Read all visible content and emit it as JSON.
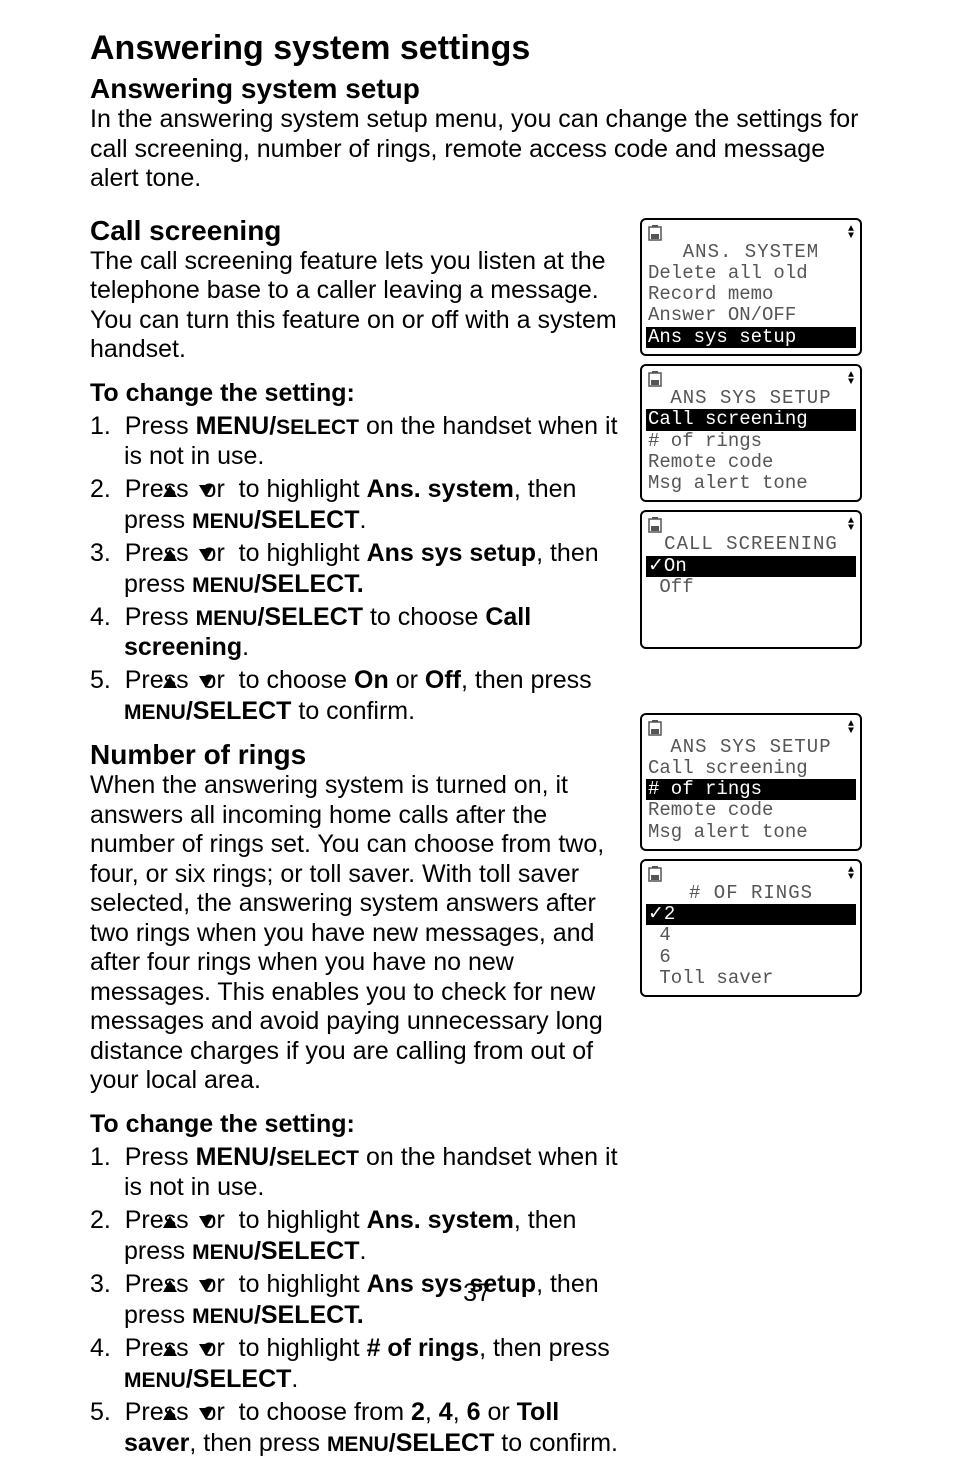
{
  "page": {
    "title": "Answering system settings",
    "number": "37"
  },
  "setup": {
    "heading": "Answering system setup",
    "intro": "In the answering system setup menu, you can change the settings for call screening, number of rings, remote access code and message alert tone."
  },
  "callScreening": {
    "heading": "Call screening",
    "intro": "The call screening feature lets you listen at the telephone base to a caller leaving a message. You can turn this feature on or off with a system handset.",
    "changeHeading": "To change the setting:",
    "step1a": "Press ",
    "menuBold": "MENU/",
    "selectSmall": "SELECT",
    "step1b": " on the handset when it is not in use.",
    "step2a": "Press ",
    "step2b": " or ",
    "step2c": " to highlight ",
    "ansSystem": "Ans. system",
    "step2d": ", then press ",
    "menuSmall": "MENU",
    "selectBold": "/SELECT",
    "period": ".",
    "step3c": " to highlight ",
    "ansSysSetup": "Ans sys setup",
    "step3d": ", then press ",
    "selectBoldDot": "/SELECT.",
    "step4a": "Press ",
    "step4b": " to choose ",
    "callScr": "Call screening",
    "step5a": "Press ",
    "step5b": " or ",
    "step5c": " to choose ",
    "on": "On",
    "orWord": " or ",
    "off": "Off",
    "step5d": ", then press ",
    "confirm": " to confirm."
  },
  "numRings": {
    "heading": "Number of rings",
    "intro": "When the answering system is turned on, it answers all incoming home calls after the number of rings set. You can choose from two, four, or six rings; or toll saver. With toll saver selected, the answering system answers after two rings when you have new messages, and after four rings when you have no new messages. This enables you to check for new messages and avoid paying unnecessary long distance charges if you are calling from out of your local area.",
    "changeHeading": "To change the setting:",
    "step4c": " to highlight ",
    "numOfRings": "# of rings",
    "step4d": ", then press ",
    "step5c2": " to choose from ",
    "two": "2",
    "comma": ", ",
    "four": "4",
    "six": "6",
    "orWord2": " or ",
    "tollSaver": "Toll saver",
    "thenPress": ", then press ",
    "confirm2": " to confirm."
  },
  "lcd1": {
    "title": "ANS. SYSTEM",
    "r1": "Delete all old",
    "r2": "Record memo",
    "r3": "Answer ON/OFF",
    "r4": "Ans sys setup"
  },
  "lcd2": {
    "title": "ANS SYS SETUP",
    "r1": "Call screening",
    "r2": "# of rings",
    "r3": "Remote code",
    "r4": "Msg alert tone"
  },
  "lcd3": {
    "title": "CALL SCREENING",
    "r1": "✓On",
    "r2": " Off"
  },
  "lcd4": {
    "title": "ANS SYS SETUP",
    "r1": "Call screening",
    "r2": "# of rings",
    "r3": "Remote code",
    "r4": "Msg alert tone"
  },
  "lcd5": {
    "title": "# OF RINGS",
    "r1": "✓2",
    "r2": " 4",
    "r3": " 6",
    "r4": " Toll saver"
  }
}
